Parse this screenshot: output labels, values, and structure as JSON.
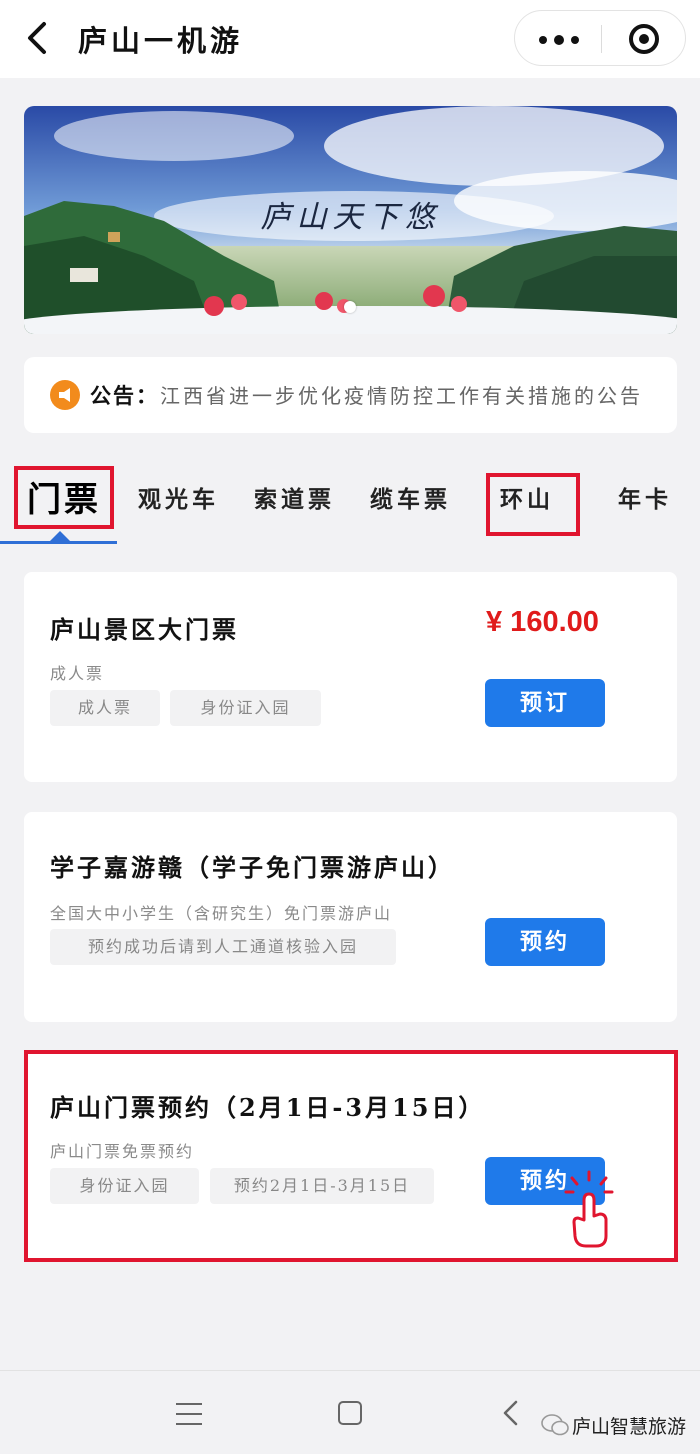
{
  "header": {
    "title": "庐山一机游"
  },
  "banner": {
    "caption": "庐山天下悠"
  },
  "notice": {
    "label": "公告：",
    "text": "江西省进一步优化疫情防控工作有关措施的公告"
  },
  "tabs": [
    {
      "label": "门票",
      "active": true
    },
    {
      "label": "观光车"
    },
    {
      "label": "索道票"
    },
    {
      "label": "缆车票"
    },
    {
      "label": "环山"
    },
    {
      "label": "年卡"
    }
  ],
  "cards": [
    {
      "title": "庐山景区大门票",
      "subtitle": "成人票",
      "tags": [
        "成人票",
        "身份证入园"
      ],
      "price": "¥ 160.00",
      "button": "预订"
    },
    {
      "title": "学子嘉游赣（学子免门票游庐山）",
      "subtitle": "全国大中小学生（含研究生）免门票游庐山",
      "tags": [
        "预约成功后请到人工通道核验入园"
      ],
      "button": "预约"
    },
    {
      "title": "庐山门票预约（2月1日-3月15日）",
      "subtitle": "庐山门票免票预约",
      "tags": [
        "身份证入园",
        "预约2月1日-3月15日"
      ],
      "button": "预约"
    }
  ],
  "watermark": "庐山智慧旅游",
  "colors": {
    "accent": "#1f7aea",
    "price": "#e01b1b",
    "highlight": "#e0152f",
    "notice_icon": "#f28b1c"
  }
}
